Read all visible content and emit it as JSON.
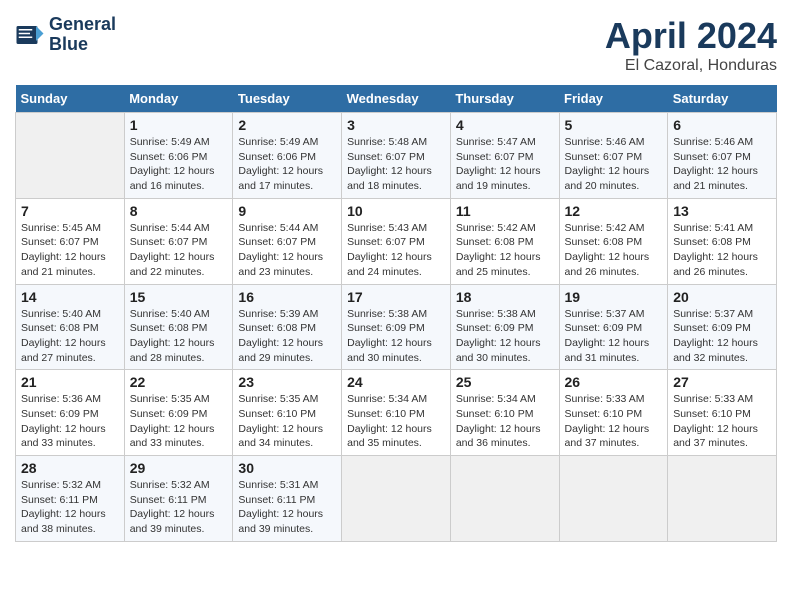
{
  "header": {
    "logo_line1": "General",
    "logo_line2": "Blue",
    "month": "April 2024",
    "location": "El Cazoral, Honduras"
  },
  "days_of_week": [
    "Sunday",
    "Monday",
    "Tuesday",
    "Wednesday",
    "Thursday",
    "Friday",
    "Saturday"
  ],
  "weeks": [
    [
      {
        "day": "",
        "empty": true
      },
      {
        "day": "1",
        "sunrise": "5:49 AM",
        "sunset": "6:06 PM",
        "daylight": "12 hours and 16 minutes."
      },
      {
        "day": "2",
        "sunrise": "5:49 AM",
        "sunset": "6:06 PM",
        "daylight": "12 hours and 17 minutes."
      },
      {
        "day": "3",
        "sunrise": "5:48 AM",
        "sunset": "6:07 PM",
        "daylight": "12 hours and 18 minutes."
      },
      {
        "day": "4",
        "sunrise": "5:47 AM",
        "sunset": "6:07 PM",
        "daylight": "12 hours and 19 minutes."
      },
      {
        "day": "5",
        "sunrise": "5:46 AM",
        "sunset": "6:07 PM",
        "daylight": "12 hours and 20 minutes."
      },
      {
        "day": "6",
        "sunrise": "5:46 AM",
        "sunset": "6:07 PM",
        "daylight": "12 hours and 21 minutes."
      }
    ],
    [
      {
        "day": "7",
        "sunrise": "5:45 AM",
        "sunset": "6:07 PM",
        "daylight": "12 hours and 21 minutes."
      },
      {
        "day": "8",
        "sunrise": "5:44 AM",
        "sunset": "6:07 PM",
        "daylight": "12 hours and 22 minutes."
      },
      {
        "day": "9",
        "sunrise": "5:44 AM",
        "sunset": "6:07 PM",
        "daylight": "12 hours and 23 minutes."
      },
      {
        "day": "10",
        "sunrise": "5:43 AM",
        "sunset": "6:07 PM",
        "daylight": "12 hours and 24 minutes."
      },
      {
        "day": "11",
        "sunrise": "5:42 AM",
        "sunset": "6:08 PM",
        "daylight": "12 hours and 25 minutes."
      },
      {
        "day": "12",
        "sunrise": "5:42 AM",
        "sunset": "6:08 PM",
        "daylight": "12 hours and 26 minutes."
      },
      {
        "day": "13",
        "sunrise": "5:41 AM",
        "sunset": "6:08 PM",
        "daylight": "12 hours and 26 minutes."
      }
    ],
    [
      {
        "day": "14",
        "sunrise": "5:40 AM",
        "sunset": "6:08 PM",
        "daylight": "12 hours and 27 minutes."
      },
      {
        "day": "15",
        "sunrise": "5:40 AM",
        "sunset": "6:08 PM",
        "daylight": "12 hours and 28 minutes."
      },
      {
        "day": "16",
        "sunrise": "5:39 AM",
        "sunset": "6:08 PM",
        "daylight": "12 hours and 29 minutes."
      },
      {
        "day": "17",
        "sunrise": "5:38 AM",
        "sunset": "6:09 PM",
        "daylight": "12 hours and 30 minutes."
      },
      {
        "day": "18",
        "sunrise": "5:38 AM",
        "sunset": "6:09 PM",
        "daylight": "12 hours and 30 minutes."
      },
      {
        "day": "19",
        "sunrise": "5:37 AM",
        "sunset": "6:09 PM",
        "daylight": "12 hours and 31 minutes."
      },
      {
        "day": "20",
        "sunrise": "5:37 AM",
        "sunset": "6:09 PM",
        "daylight": "12 hours and 32 minutes."
      }
    ],
    [
      {
        "day": "21",
        "sunrise": "5:36 AM",
        "sunset": "6:09 PM",
        "daylight": "12 hours and 33 minutes."
      },
      {
        "day": "22",
        "sunrise": "5:35 AM",
        "sunset": "6:09 PM",
        "daylight": "12 hours and 33 minutes."
      },
      {
        "day": "23",
        "sunrise": "5:35 AM",
        "sunset": "6:10 PM",
        "daylight": "12 hours and 34 minutes."
      },
      {
        "day": "24",
        "sunrise": "5:34 AM",
        "sunset": "6:10 PM",
        "daylight": "12 hours and 35 minutes."
      },
      {
        "day": "25",
        "sunrise": "5:34 AM",
        "sunset": "6:10 PM",
        "daylight": "12 hours and 36 minutes."
      },
      {
        "day": "26",
        "sunrise": "5:33 AM",
        "sunset": "6:10 PM",
        "daylight": "12 hours and 37 minutes."
      },
      {
        "day": "27",
        "sunrise": "5:33 AM",
        "sunset": "6:10 PM",
        "daylight": "12 hours and 37 minutes."
      }
    ],
    [
      {
        "day": "28",
        "sunrise": "5:32 AM",
        "sunset": "6:11 PM",
        "daylight": "12 hours and 38 minutes."
      },
      {
        "day": "29",
        "sunrise": "5:32 AM",
        "sunset": "6:11 PM",
        "daylight": "12 hours and 39 minutes."
      },
      {
        "day": "30",
        "sunrise": "5:31 AM",
        "sunset": "6:11 PM",
        "daylight": "12 hours and 39 minutes."
      },
      {
        "day": "",
        "empty": true
      },
      {
        "day": "",
        "empty": true
      },
      {
        "day": "",
        "empty": true
      },
      {
        "day": "",
        "empty": true
      }
    ]
  ]
}
